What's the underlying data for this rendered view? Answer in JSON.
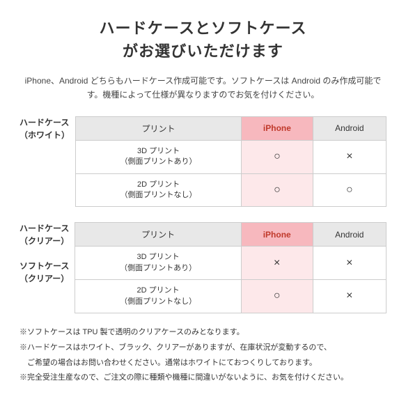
{
  "title": {
    "line1": "ハードケースとソフトケース",
    "line2": "がお選びいただけます"
  },
  "description": "iPhone、Android どちらもハードケース作成可能です。ソフトケースは\nAndroid のみ作成可能です。機種によって仕様が異なりますのでお気を付けください。",
  "table1": {
    "rowHeader": "ハードケース\n（ホワイト）",
    "headers": [
      "プリント",
      "iPhone",
      "Android"
    ],
    "rows": [
      {
        "print": "3D プリント\n（側面プリントあり）",
        "iphone": "○",
        "android": "×"
      },
      {
        "print": "2D プリント\n（側面プリントなし）",
        "iphone": "○",
        "android": "○"
      }
    ]
  },
  "table2": {
    "rowHeader1": "ハードケース\n（クリアー）",
    "rowHeader2": "ソフトケース\n（クリアー）",
    "headers": [
      "プリント",
      "iPhone",
      "Android"
    ],
    "rows": [
      {
        "print": "3D プリント\n（側面プリントあり）",
        "iphone": "×",
        "android": "×"
      },
      {
        "print": "2D プリント\n（側面プリントなし）",
        "iphone": "○",
        "android": "×"
      }
    ]
  },
  "notes": [
    "※ソフトケースは TPU 製で透明のクリアケースのみとなります。",
    "※ハードケースはホワイト、ブラック、クリアーがありますが、在庫状況が変動するので、",
    "　ご希望の場合はお問い合わせください。通常はホワイトにておつくりしております。",
    "※完全受注生産なので、ご注文の際に種類や機種に間違いがないように、お気を付けください。"
  ]
}
